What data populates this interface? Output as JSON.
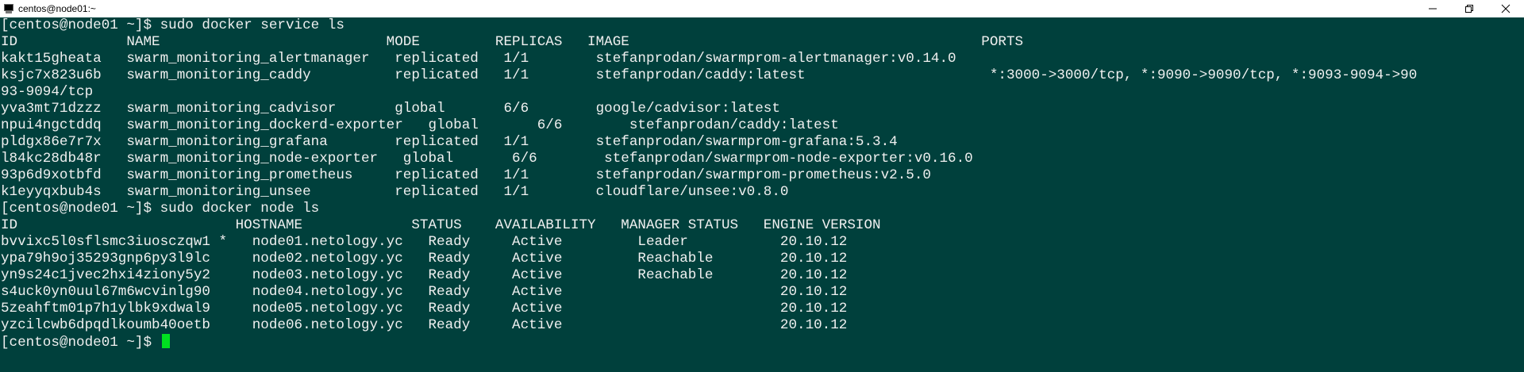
{
  "window": {
    "title": "centos@node01:~",
    "icon": "terminal-icon",
    "minimize_icon": "minimize-icon",
    "restore_icon": "restore-icon",
    "close_icon": "close-icon"
  },
  "terminal": {
    "background": "#00403c",
    "foreground": "#f0f0f0",
    "cursor_color": "#00e020",
    "lines": [
      "[centos@node01 ~]$ sudo docker service ls",
      "ID             NAME                           MODE         REPLICAS   IMAGE                                          PORTS",
      "kakt15gheata   swarm_monitoring_alertmanager   replicated   1/1        stefanprodan/swarmprom-alertmanager:v0.14.0",
      "ksjc7x823u6b   swarm_monitoring_caddy          replicated   1/1        stefanprodan/caddy:latest                      *:3000->3000/tcp, *:9090->9090/tcp, *:9093-9094->90",
      "93-9094/tcp",
      "yva3mt71dzzz   swarm_monitoring_cadvisor       global       6/6        google/cadvisor:latest",
      "npui4ngctddq   swarm_monitoring_dockerd-exporter   global       6/6        stefanprodan/caddy:latest",
      "pldgx86e7r7x   swarm_monitoring_grafana        replicated   1/1        stefanprodan/swarmprom-grafana:5.3.4",
      "l84kc28db48r   swarm_monitoring_node-exporter   global       6/6        stefanprodan/swarmprom-node-exporter:v0.16.0",
      "93p6d9xotbfd   swarm_monitoring_prometheus     replicated   1/1        stefanprodan/swarmprom-prometheus:v2.5.0",
      "k1eyyqxbub4s   swarm_monitoring_unsee          replicated   1/1        cloudflare/unsee:v0.8.0",
      "[centos@node01 ~]$ sudo docker node ls",
      "ID                          HOSTNAME             STATUS    AVAILABILITY   MANAGER STATUS   ENGINE VERSION",
      "bvvixc5l0sflsmc3iuosczqw1 *   node01.netology.yc   Ready     Active         Leader           20.10.12",
      "ypa79h9oj35293gnp6py3l9lc     node02.netology.yc   Ready     Active         Reachable        20.10.12",
      "yn9s24c1jvec2hxi4ziony5y2     node03.netology.yc   Ready     Active         Reachable        20.10.12",
      "s4uck0yn0uul67m6wcvinlg90     node04.netology.yc   Ready     Active                          20.10.12",
      "5zeahftm01p7h1ylbk9xdwal9     node05.netology.yc   Ready     Active                          20.10.12",
      "yzcilcwb6dpqdlkoumb40oetb     node06.netology.yc   Ready     Active                          20.10.12"
    ],
    "prompt": "[centos@node01 ~]$ "
  }
}
